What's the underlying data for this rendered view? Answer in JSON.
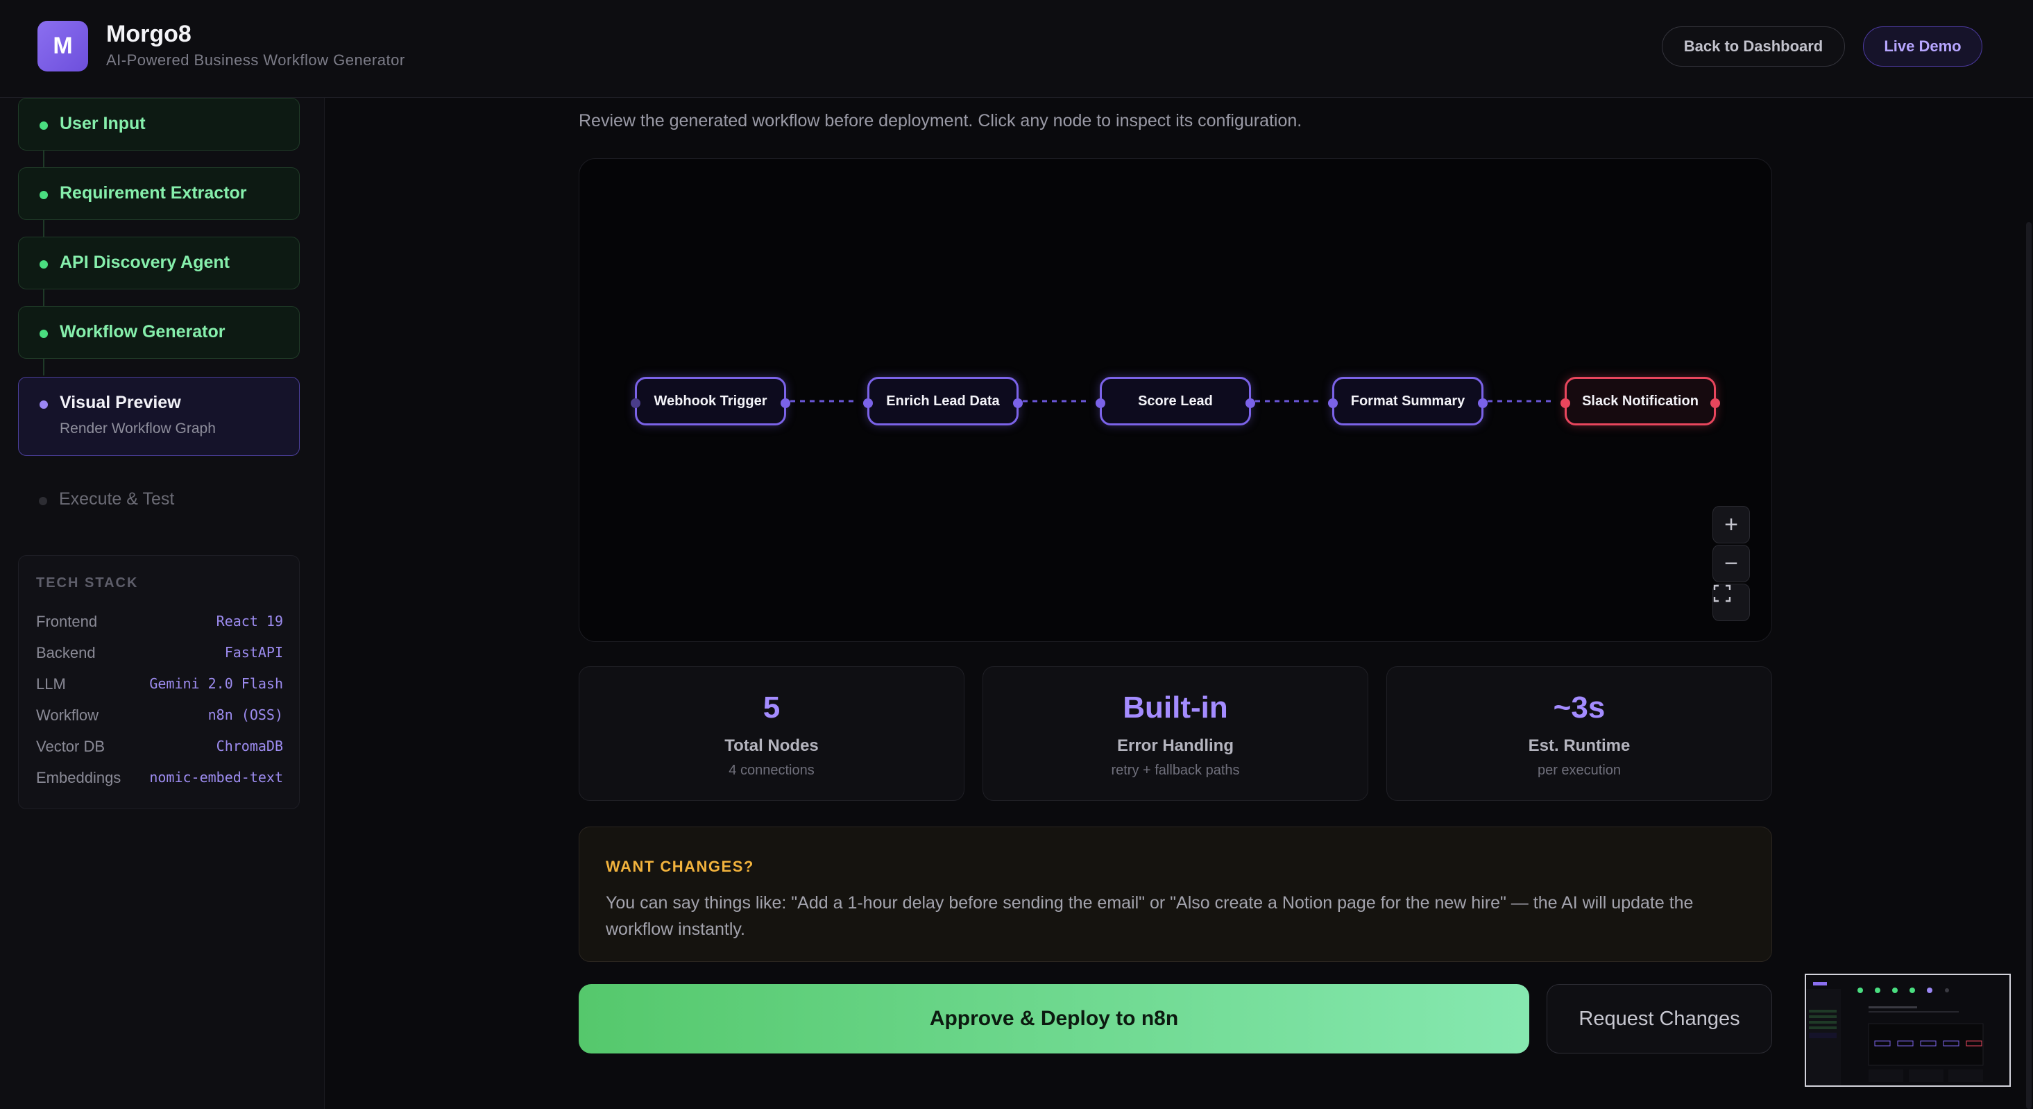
{
  "app": {
    "logo_letter": "M",
    "name": "Morgo8",
    "subtitle": "AI-Powered Business Workflow Generator"
  },
  "header": {
    "back_label": "Back to Dashboard",
    "live_label": "Live Demo"
  },
  "sidebar": {
    "steps": [
      {
        "label": "User Input",
        "status": "done"
      },
      {
        "label": "Requirement Extractor",
        "status": "done"
      },
      {
        "label": "API Discovery Agent",
        "status": "done"
      },
      {
        "label": "Workflow Generator",
        "status": "done"
      },
      {
        "label": "Visual Preview",
        "sub": "Render Workflow Graph",
        "status": "active"
      },
      {
        "label": "Execute & Test",
        "status": "pending"
      }
    ],
    "tech_stack": {
      "title": "TECH STACK",
      "rows": [
        {
          "key": "Frontend",
          "value": "React 19"
        },
        {
          "key": "Backend",
          "value": "FastAPI"
        },
        {
          "key": "LLM",
          "value": "Gemini 2.0 Flash"
        },
        {
          "key": "Workflow",
          "value": "n8n (OSS)"
        },
        {
          "key": "Vector DB",
          "value": "ChromaDB"
        },
        {
          "key": "Embeddings",
          "value": "nomic-embed-text"
        }
      ]
    }
  },
  "main": {
    "intro": "Review the generated workflow before deployment. Click any node to inspect its configuration.",
    "nodes": [
      {
        "label": "Webhook Trigger",
        "kind": "trigger"
      },
      {
        "label": "Enrich Lead Data",
        "kind": "action"
      },
      {
        "label": "Score Lead",
        "kind": "action"
      },
      {
        "label": "Format Summary",
        "kind": "action"
      },
      {
        "label": "Slack Notification",
        "kind": "output"
      }
    ],
    "zoom_controls": {
      "zoom_in": "+",
      "zoom_out": "−",
      "fit": "⛶"
    },
    "stats": [
      {
        "value": "5",
        "title": "Total Nodes",
        "sub": "4 connections"
      },
      {
        "value": "Built-in",
        "title": "Error Handling",
        "sub": "retry + fallback paths"
      },
      {
        "value": "~3s",
        "title": "Est. Runtime",
        "sub": "per execution"
      }
    ],
    "changes": {
      "heading": "WANT CHANGES?",
      "body": "You can say things like: \"Add a 1-hour delay before sending the email\" or \"Also create a Notion page for the new hire\" — the AI will update the workflow instantly."
    },
    "approve_label": "Approve & Deploy to n8n",
    "request_label": "Request Changes"
  },
  "colors": {
    "accent": "#7b63e8",
    "success": "#4ade80",
    "danger": "#e8465d",
    "warning": "#f2b33d"
  }
}
